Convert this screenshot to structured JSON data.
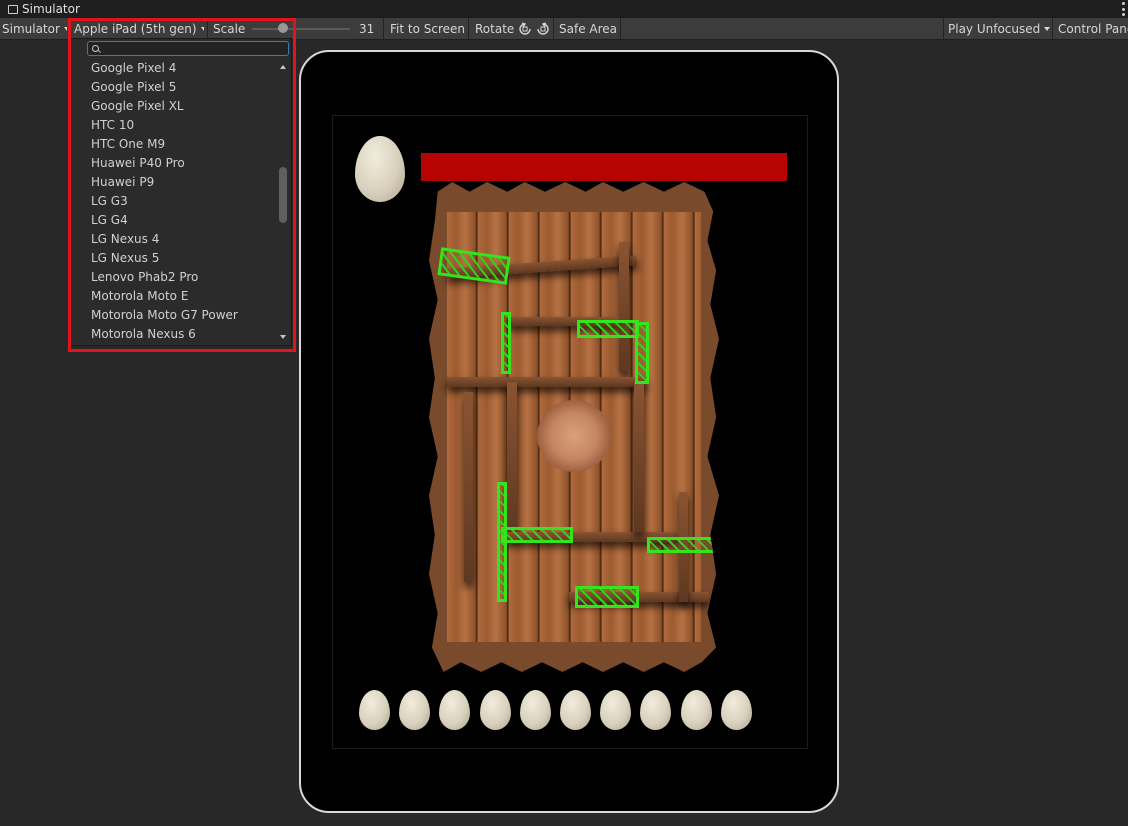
{
  "window": {
    "title": "Simulator"
  },
  "toolbar": {
    "view_mode": "Simulator",
    "device": "Apple iPad (5th gen)",
    "scale_label": "Scale",
    "scale_value": "31",
    "scale_fraction": 0.35,
    "fit_to_screen": "Fit to Screen",
    "rotate": "Rotate",
    "safe_area": "Safe Area",
    "play_mode": "Play Unfocused",
    "control_panel": "Control Panel"
  },
  "device_dropdown": {
    "search_value": "",
    "items": [
      "Google Pixel 4",
      "Google Pixel 5",
      "Google Pixel XL",
      "HTC 10",
      "HTC One M9",
      "Huawei P40 Pro",
      "Huawei P9",
      "LG G3",
      "LG G4",
      "LG Nexus 4",
      "LG Nexus 5",
      "Lenovo Phab2 Pro",
      "Motorola Moto E",
      "Motorola Moto G7 Power",
      "Motorola Nexus 6"
    ]
  },
  "game": {
    "health_fraction": 1.0,
    "health_color": "#b80303",
    "eggs_remaining": 10
  },
  "colors": {
    "highlight": "#e0141a",
    "accent": "#3a79bb",
    "platform_green": "#35e41c"
  }
}
